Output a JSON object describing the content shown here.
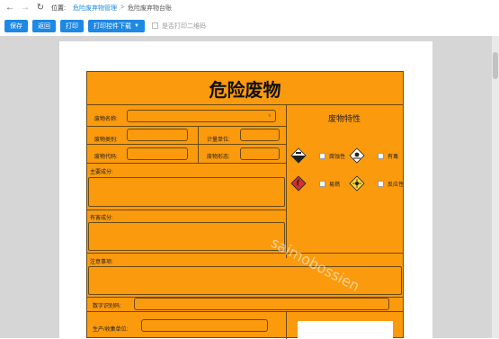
{
  "nav": {
    "location_label": "位置:",
    "crumb_link": "危险废弃物管理",
    "crumb_sep": ">",
    "crumb_current": "危险废弃物台账"
  },
  "toolbar": {
    "save": "保存",
    "back": "返回",
    "print": "打印",
    "plugin_download": "打印控件下载",
    "print_qr_label": "是否打印二维码"
  },
  "label": {
    "title": "危险废物",
    "waste_name": "废物名称:",
    "waste_category": "废物类别:",
    "unit": "计量单位:",
    "waste_code": "废物代码:",
    "waste_form": "废物形态:",
    "main_components": "主要成分:",
    "harmful_components": "有害成分:",
    "precautions": "注意事项:",
    "digital_code": "数字识别码:",
    "producer": "生产/收集单位:",
    "traits_title": "废物特性",
    "traits": [
      "腐蚀性",
      "有毒",
      "易燃",
      "反应性"
    ],
    "watermark": "saimobossien"
  },
  "colors": {
    "accent": "#1e88e5",
    "label_orange": "#fb9a0c"
  }
}
